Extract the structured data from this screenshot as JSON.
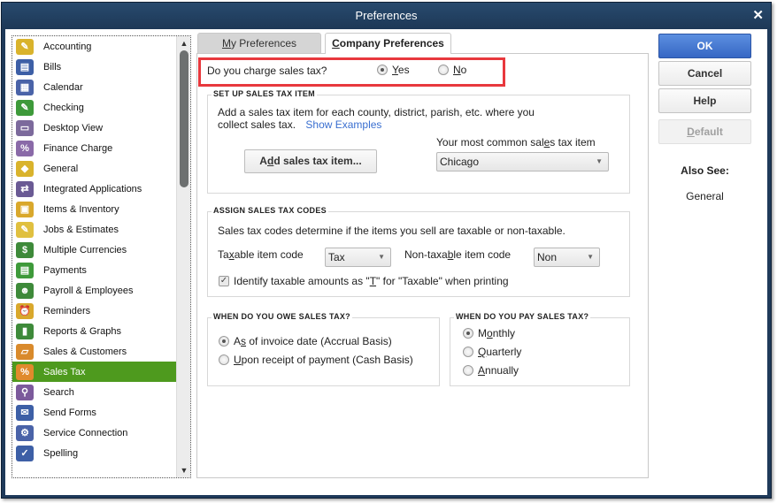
{
  "window": {
    "title": "Preferences",
    "close_icon": "close-icon"
  },
  "sidebar": {
    "selected": "Sales Tax",
    "items": [
      {
        "label": "Accounting",
        "icon": "accounting-icon",
        "color": "#d9b32c"
      },
      {
        "label": "Bills",
        "icon": "bills-icon",
        "color": "#3d5fa6"
      },
      {
        "label": "Calendar",
        "icon": "calendar-icon",
        "color": "#4a63a8"
      },
      {
        "label": "Checking",
        "icon": "checking-icon",
        "color": "#3e9a3a"
      },
      {
        "label": "Desktop View",
        "icon": "desktop-view-icon",
        "color": "#7c6a9c"
      },
      {
        "label": "Finance Charge",
        "icon": "finance-charge-icon",
        "color": "#8a6aa8"
      },
      {
        "label": "General",
        "icon": "general-icon",
        "color": "#d9b32c"
      },
      {
        "label": "Integrated Applications",
        "icon": "integrated-applications-icon",
        "color": "#6a5a94"
      },
      {
        "label": "Items & Inventory",
        "icon": "items-inventory-icon",
        "color": "#d9a82c"
      },
      {
        "label": "Jobs & Estimates",
        "icon": "jobs-estimates-icon",
        "color": "#e0c040"
      },
      {
        "label": "Multiple Currencies",
        "icon": "multiple-currencies-icon",
        "color": "#3e8a3a"
      },
      {
        "label": "Payments",
        "icon": "payments-icon",
        "color": "#3e9a3a"
      },
      {
        "label": "Payroll & Employees",
        "icon": "payroll-employees-icon",
        "color": "#3e8a3a"
      },
      {
        "label": "Reminders",
        "icon": "reminders-icon",
        "color": "#d9a82c"
      },
      {
        "label": "Reports & Graphs",
        "icon": "reports-graphs-icon",
        "color": "#3e8a3a"
      },
      {
        "label": "Sales & Customers",
        "icon": "sales-customers-icon",
        "color": "#d98a2c"
      },
      {
        "label": "Sales Tax",
        "icon": "sales-tax-icon",
        "color": "#e08a2c"
      },
      {
        "label": "Search",
        "icon": "search-icon",
        "color": "#7c5a9c"
      },
      {
        "label": "Send Forms",
        "icon": "send-forms-icon",
        "color": "#3d5fa6"
      },
      {
        "label": "Service Connection",
        "icon": "service-connection-icon",
        "color": "#4a63a8"
      },
      {
        "label": "Spelling",
        "icon": "spelling-icon",
        "color": "#3d5fa6"
      }
    ]
  },
  "tabs": [
    {
      "label_u": "M",
      "label_rest": "y Preferences",
      "active": false
    },
    {
      "label_u": "C",
      "label_rest": "ompany Preferences",
      "active": true
    }
  ],
  "charge": {
    "question": "Do you charge sales tax?",
    "yes_u": "Y",
    "yes_rest": "es",
    "no_u": "N",
    "no_rest": "o",
    "selected": "Yes"
  },
  "setup": {
    "title": "SET UP SALES TAX ITEM",
    "line1": "Add a sales tax item for each county, district, parish, etc. where you",
    "line2": "collect sales tax.",
    "show_examples": "Show Examples",
    "add_btn_a": "A",
    "add_btn_u": "d",
    "add_btn_rest": "d sales tax item...",
    "common_label_a": "Your most common sal",
    "common_label_u": "e",
    "common_label_rest": "s tax item",
    "common_value": "Chicago"
  },
  "codes": {
    "title": "ASSIGN SALES TAX CODES",
    "desc": "Sales tax codes determine if the items you sell are taxable or non-taxable.",
    "taxable_a": "Ta",
    "taxable_u": "x",
    "taxable_rest": "able item code",
    "taxable_value": "Tax",
    "nontaxable_a": "Non-taxa",
    "nontaxable_u": "b",
    "nontaxable_rest": "le item code",
    "nontaxable_value": "Non",
    "identify_a": "Identify taxable amounts as \"",
    "identify_u": "T",
    "identify_rest": "\" for \"Taxable\" when printing",
    "identify_checked": true
  },
  "owe": {
    "title": "WHEN DO YOU OWE SALES TAX?",
    "opt1_a": "A",
    "opt1_u": "s",
    "opt1_rest": " of invoice date (Accrual Basis)",
    "opt2_u": "U",
    "opt2_rest": "pon receipt of payment (Cash Basis)",
    "selected": "Accrual Basis"
  },
  "pay": {
    "title": "WHEN DO YOU PAY SALES TAX?",
    "opt1_a": "M",
    "opt1_u": "o",
    "opt1_rest": "nthly",
    "opt2_u": "Q",
    "opt2_rest": "uarterly",
    "opt3_u": "A",
    "opt3_rest": "nnually",
    "selected": "Monthly"
  },
  "buttons": {
    "ok": "OK",
    "cancel": "Cancel",
    "help": "Help",
    "default_u": "D",
    "default_rest": "efault"
  },
  "also_see": {
    "title": "Also See:",
    "links": [
      "General"
    ]
  },
  "colors": {
    "selected_item": "#4e9a1e",
    "highlight_box": "#e8383d",
    "ok_button": "#3f72cf",
    "title_bar": "#1f3a5a",
    "link": "#3a6fd0"
  }
}
